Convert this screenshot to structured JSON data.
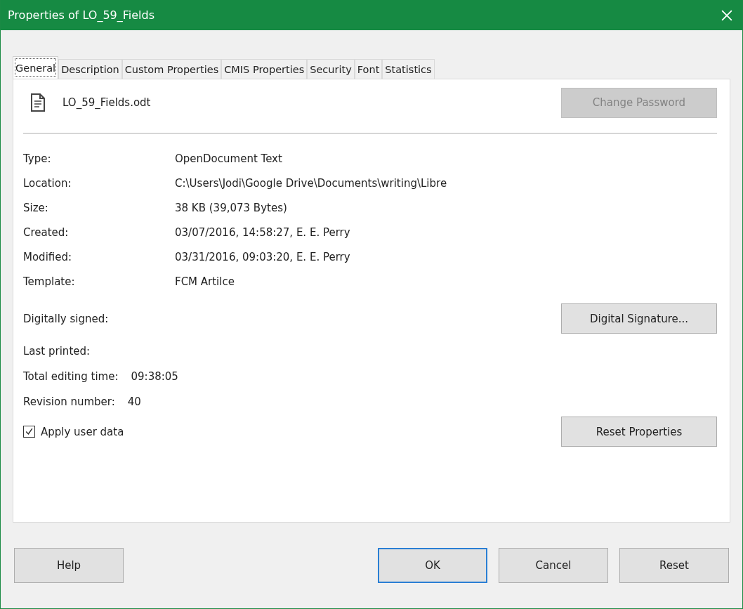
{
  "window": {
    "title": "Properties of LO_59_Fields"
  },
  "tabs": [
    {
      "label": "General",
      "selected": true
    },
    {
      "label": "Description",
      "selected": false
    },
    {
      "label": "Custom Properties",
      "selected": false
    },
    {
      "label": "CMIS Properties",
      "selected": false
    },
    {
      "label": "Security",
      "selected": false
    },
    {
      "label": "Font",
      "selected": false
    },
    {
      "label": "Statistics",
      "selected": false
    }
  ],
  "file": {
    "name": "LO_59_Fields.odt",
    "change_password": {
      "label": "Change Password",
      "disabled": true
    }
  },
  "properties": [
    {
      "label": "Type:",
      "value": "OpenDocument Text"
    },
    {
      "label": "Location:",
      "value": "C:\\Users\\Jodi\\Google Drive\\Documents\\writing\\Libre"
    },
    {
      "label": "Size:",
      "value": "38 KB (39,073 Bytes)"
    },
    {
      "label": "Created:",
      "value": "03/07/2016, 14:58:27, E. E. Perry"
    },
    {
      "label": "Modified:",
      "value": "03/31/2016, 09:03:20, E. E. Perry"
    },
    {
      "label": "Template:",
      "value": "FCM Artilce"
    }
  ],
  "signature": {
    "label": "Digitally signed:",
    "button": "Digital Signature..."
  },
  "stats": [
    {
      "label": "Last printed:"
    },
    {
      "label": "Total editing time:",
      "value": "09:38:05"
    },
    {
      "label": "Revision number:",
      "value": "40"
    }
  ],
  "apply_user_data": {
    "label": "Apply user data",
    "checked": true
  },
  "reset_properties": "Reset Properties",
  "buttons": [
    {
      "label": "Help",
      "default": false
    },
    {
      "label": "OK",
      "default": true
    },
    {
      "label": "Cancel",
      "default": false
    },
    {
      "label": "Reset",
      "default": false
    }
  ]
}
